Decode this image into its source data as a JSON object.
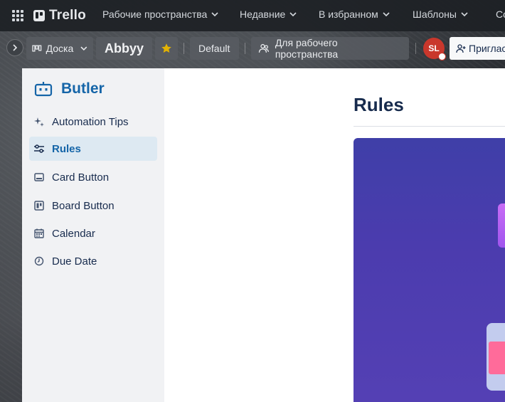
{
  "header": {
    "app_name": "Trello",
    "nav": [
      {
        "label": "Рабочие пространства"
      },
      {
        "label": "Недавние"
      },
      {
        "label": "В избранном"
      },
      {
        "label": "Шаблоны"
      },
      {
        "label": "Со"
      }
    ]
  },
  "board_bar": {
    "view_label": "Доска",
    "board_title": "Abbyy",
    "default_label": "Default",
    "visibility_label": "Для рабочего пространства",
    "avatar_initials": "SL",
    "invite_label": "Приглас"
  },
  "butler": {
    "brand": "Butler",
    "items": [
      {
        "label": "Automation Tips",
        "icon": "sparkle-icon"
      },
      {
        "label": "Rules",
        "icon": "sliders-icon",
        "active": true
      },
      {
        "label": "Card Button",
        "icon": "card-button-icon"
      },
      {
        "label": "Board Button",
        "icon": "board-button-icon"
      },
      {
        "label": "Calendar",
        "icon": "calendar-icon"
      },
      {
        "label": "Due Date",
        "icon": "clock-icon"
      }
    ],
    "content_title": "Rules"
  },
  "colors": {
    "header_bg": "#1d2125",
    "brand_blue": "#1565a8",
    "active_item_bg": "#dde9f2",
    "avatar_red": "#c9372c",
    "hero_purple": "#4b3cae"
  }
}
